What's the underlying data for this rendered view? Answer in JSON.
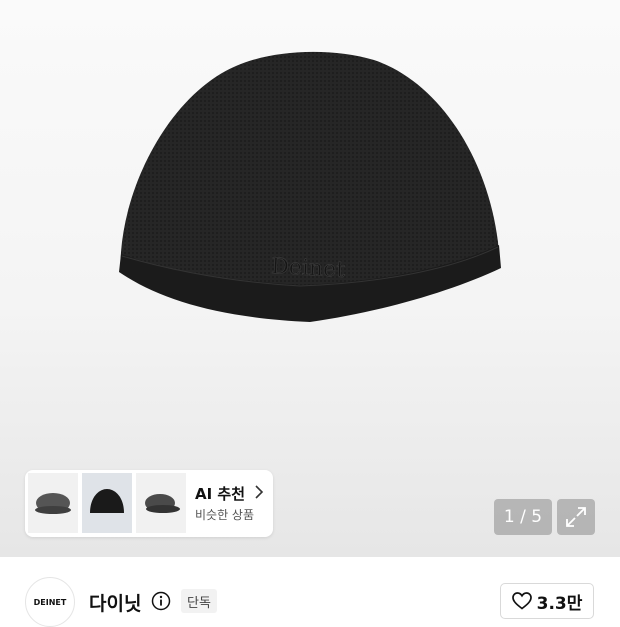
{
  "product": {
    "image_alt": "Deinet black waffle knit beanie",
    "embroidery_text": "Deinet"
  },
  "ai_recommend": {
    "title": "AI 추천",
    "subtitle": "비슷한 상품",
    "chevron_icon": "chevron-right-icon",
    "thumbnails": [
      {
        "name": "gray-newsboy-cap"
      },
      {
        "name": "black-beanie",
        "selected": true
      },
      {
        "name": "gray-flat-cap"
      }
    ]
  },
  "gallery": {
    "counter": "1 / 5",
    "expand_icon": "expand-icon"
  },
  "brand": {
    "logo_text": "DEINET",
    "name": "다이닛",
    "info_icon": "info-icon",
    "badge": "단독"
  },
  "like": {
    "icon": "heart-icon",
    "count": "3.3만"
  }
}
